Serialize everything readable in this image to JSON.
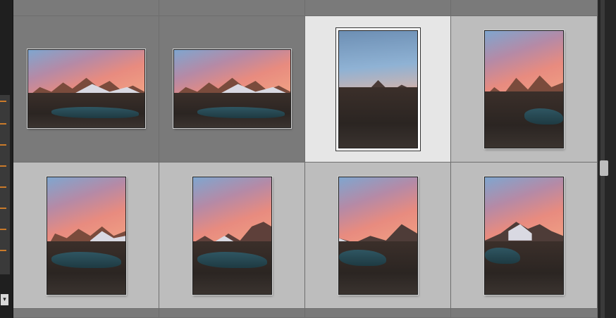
{
  "grid": {
    "thumbnails": [
      {
        "id": "t1",
        "selected": false,
        "sky": "warm",
        "lake": true,
        "orientation": "landscape"
      },
      {
        "id": "t2",
        "selected": false,
        "sky": "warm",
        "lake": true,
        "orientation": "landscape"
      },
      {
        "id": "t3",
        "selected": true,
        "sky": "cool",
        "lake": false,
        "orientation": "portrait"
      },
      {
        "id": "t4",
        "selected": false,
        "sky": "warm",
        "lake": true,
        "orientation": "portrait"
      },
      {
        "id": "t5",
        "selected": false,
        "sky": "warm",
        "lake": true,
        "orientation": "portrait"
      },
      {
        "id": "t6",
        "selected": false,
        "sky": "warm",
        "lake": true,
        "orientation": "portrait"
      },
      {
        "id": "t7",
        "selected": false,
        "sky": "warm",
        "lake": true,
        "orientation": "portrait"
      },
      {
        "id": "t8",
        "selected": false,
        "sky": "warm",
        "lake": true,
        "orientation": "portrait"
      }
    ]
  },
  "colors": {
    "cell_dim": "#7a7a7a",
    "cell_normal": "#bdbdbd",
    "cell_selected": "#e6e6e6",
    "panel_accent": "#c97a2a"
  },
  "left_panel": {
    "caret_glyph": "▾"
  }
}
